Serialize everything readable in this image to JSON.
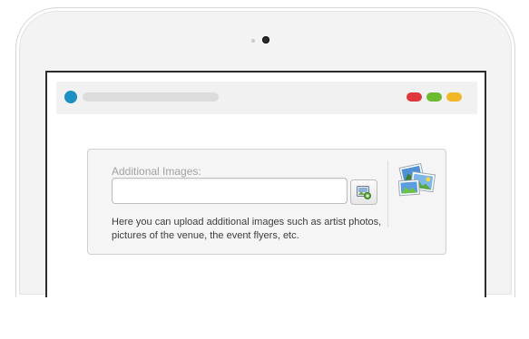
{
  "form": {
    "label": "Additional Images:",
    "input_value": "",
    "help_text": "Here you can upload additional images such as artist photos, pictures of the venue, the event flyers, etc."
  },
  "icons": {
    "browse": "image-browse-icon",
    "gallery": "pictures-icon"
  },
  "colors": {
    "browser_dot": "#1d8fc2",
    "window_close": "#e0373d",
    "window_minimize": "#6cba2f",
    "window_maximize": "#f2b728"
  }
}
